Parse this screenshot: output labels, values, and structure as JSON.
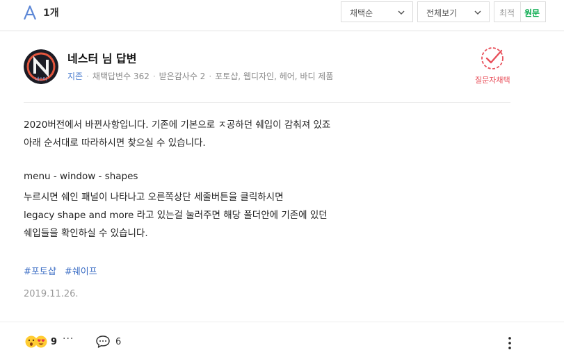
{
  "header": {
    "answer_count": "1개",
    "sort_select": "채택순",
    "view_select": "전체보기",
    "segment": {
      "latest": "최적",
      "original": "원문"
    }
  },
  "answer": {
    "author": "네스터 님 답변",
    "avatar_text": "네스티",
    "meta": {
      "grade": "지존",
      "adopted": "채택답변수 362",
      "thanks": "받은감사수 2",
      "fields": "포토샵, 웹디자인, 헤어, 바디 제품"
    },
    "adopt_label": "질문자채택",
    "body_lines": [
      "2020버전에서 바뀐사항입니다. 기존에 기본으로 ㅈ공하던 쉐입이 감춰져 있죠",
      "아래 순서대로 따라하시면 찾으실 수 있습니다.",
      "",
      "menu - window - shapes",
      "누르시면 쉐인 패널이 나타나고 오른쪽상단 세줄버튼을 클릭하시면",
      "legacy shape and more 라고 있는걸 눌러주면 해당 폴더안에 기존에 있던",
      "쉐입들을 확인하실 수 있습니다."
    ],
    "tags": [
      "#포토샵",
      "#쉐이프"
    ],
    "date": "2019.11.26.",
    "reactions": {
      "count": "9",
      "more": "···"
    },
    "comments": "6"
  },
  "icons": {
    "answer_badge": "answer-a-icon",
    "chevron": "chevron-down-icon",
    "adopt": "check-stamp-icon",
    "comment": "speech-bubble-icon",
    "more": "kebab-icon"
  },
  "colors": {
    "accent_blue": "#3a6cc4",
    "adopt_red": "#e8505b",
    "original_green": "#03a94a"
  }
}
